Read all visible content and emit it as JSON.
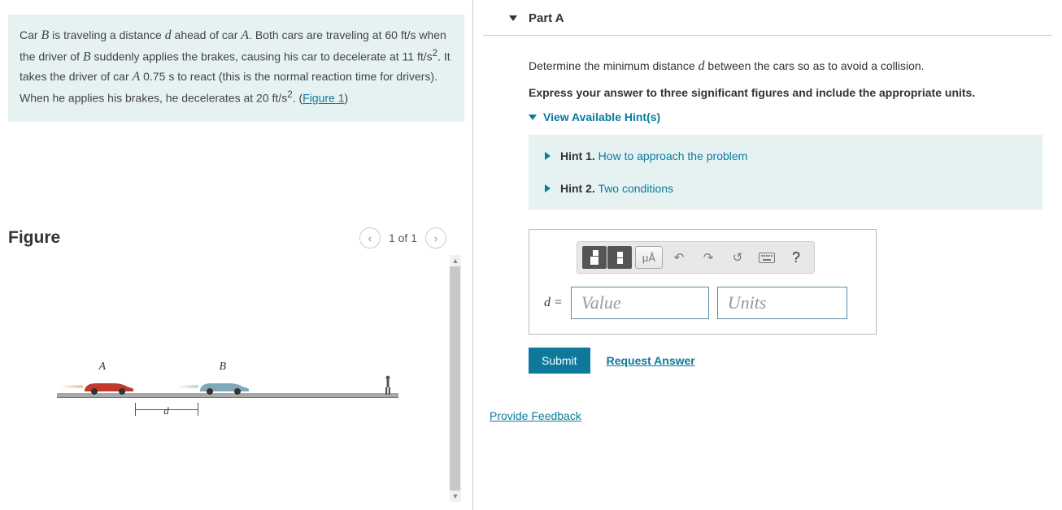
{
  "problem": {
    "text_parts": {
      "p1": "Car ",
      "B": "B",
      "p2": " is traveling a distance ",
      "d": "d",
      "p3": " ahead of car ",
      "A": "A",
      "p4": ". Both cars are traveling at 60 ",
      "u1": "ft/s",
      "p5": " when the driver of ",
      "p6": " suddenly applies the brakes, causing his car to decelerate at 11 ",
      "u2": "ft/s",
      "sq": "2",
      "p7": ". It takes the driver of car ",
      "p8": " 0.75 s to react (this is the normal reaction time for drivers). When he applies his brakes, he decelerates at 20 ",
      "p9": ". (",
      "figlink": "Figure 1",
      "p10": ")"
    }
  },
  "figure": {
    "title": "Figure",
    "pager": "1 of 1",
    "labelA": "A",
    "labelB": "B",
    "dim": "d"
  },
  "partA": {
    "title": "Part A",
    "prompt_pre": "Determine the minimum distance ",
    "prompt_var": "d",
    "prompt_post": " between the cars so as to avoid a collision.",
    "instruction": "Express your answer to three significant figures and include the appropriate units.",
    "hints_toggle": "View Available Hint(s)",
    "hints": [
      {
        "label": "Hint 1.",
        "text": "How to approach the problem"
      },
      {
        "label": "Hint 2.",
        "text": "Two conditions"
      }
    ],
    "toolbar": {
      "mu": "μÅ",
      "help": "?"
    },
    "eq_label": "d =",
    "value_placeholder": "Value",
    "units_placeholder": "Units",
    "submit": "Submit",
    "request": "Request Answer"
  },
  "feedback": "Provide Feedback"
}
